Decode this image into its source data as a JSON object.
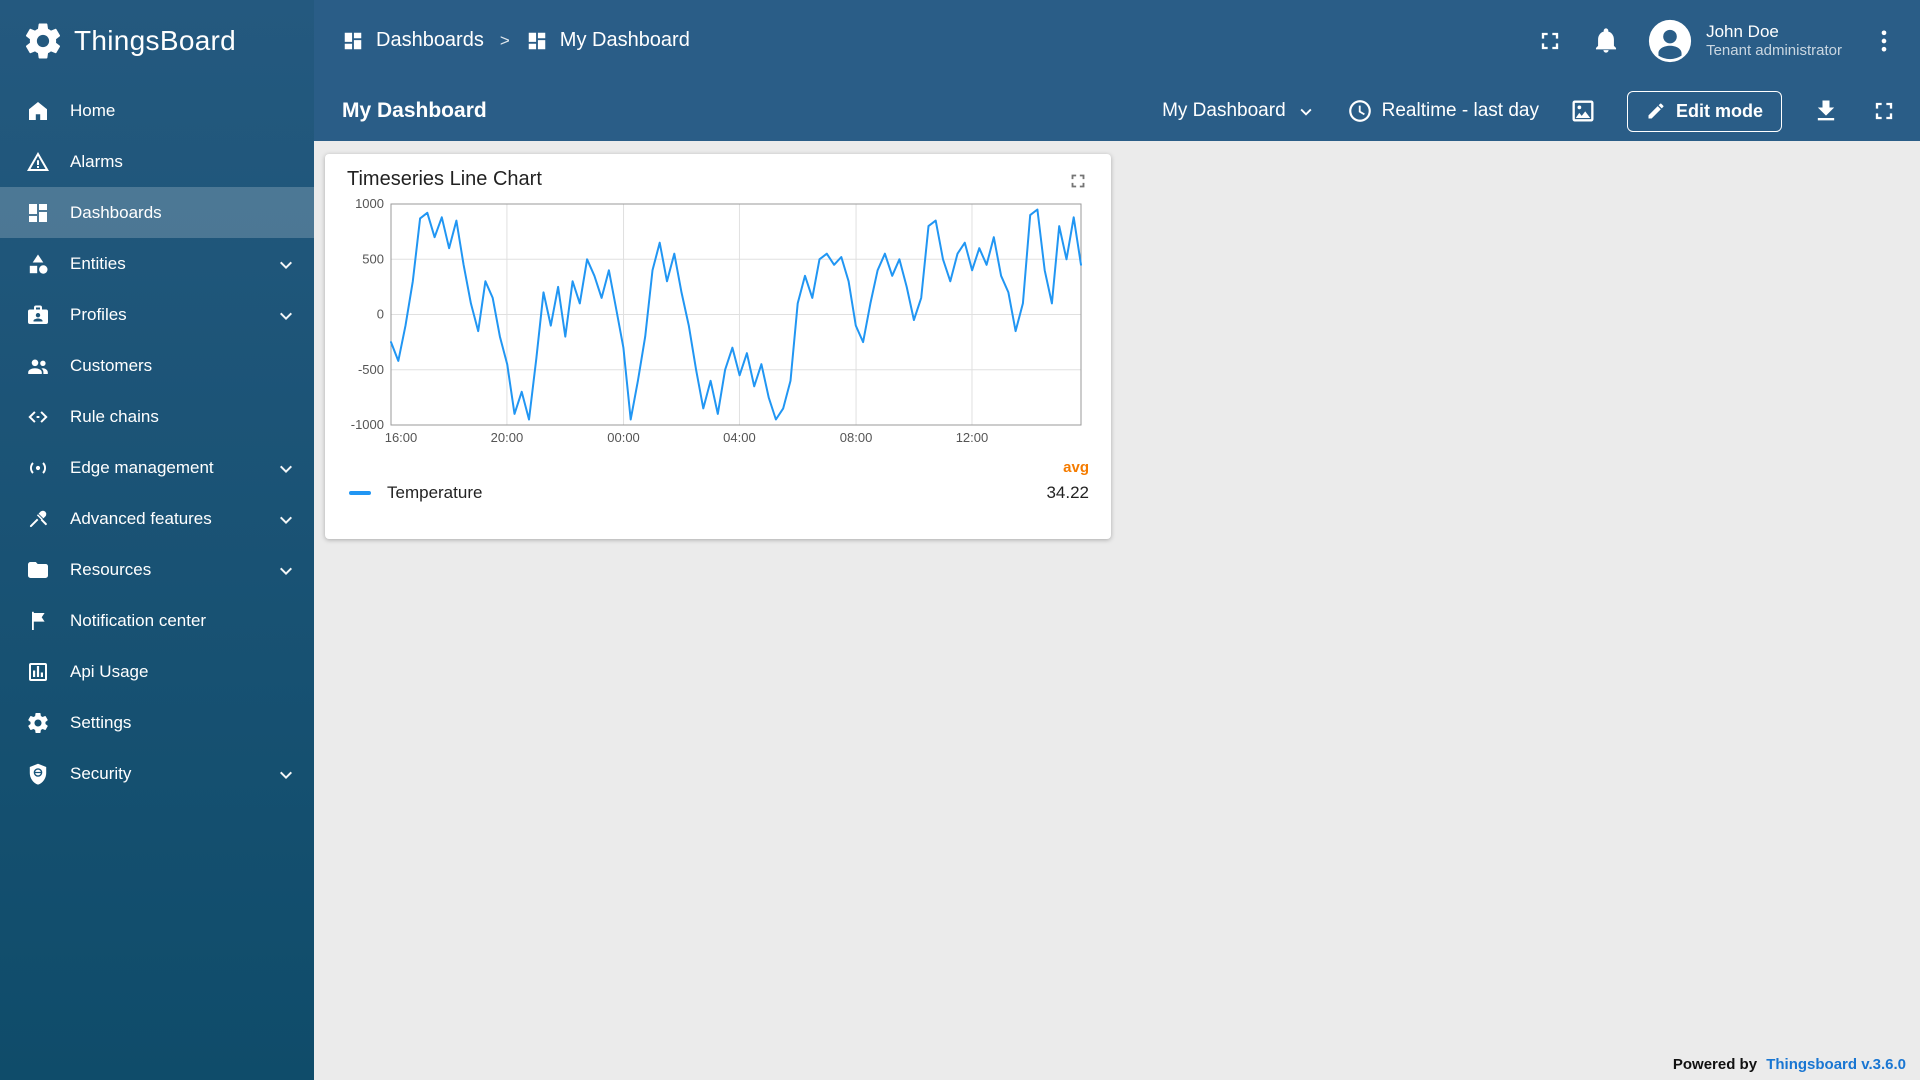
{
  "app": {
    "name": "ThingsBoard"
  },
  "sidebar": {
    "items": [
      {
        "label": "Home",
        "icon": "home",
        "expandable": false,
        "active": false
      },
      {
        "label": "Alarms",
        "icon": "alarms",
        "expandable": false,
        "active": false
      },
      {
        "label": "Dashboards",
        "icon": "dashboards",
        "expandable": false,
        "active": true
      },
      {
        "label": "Entities",
        "icon": "entities",
        "expandable": true,
        "active": false
      },
      {
        "label": "Profiles",
        "icon": "profiles",
        "expandable": true,
        "active": false
      },
      {
        "label": "Customers",
        "icon": "customers",
        "expandable": false,
        "active": false
      },
      {
        "label": "Rule chains",
        "icon": "rule-chains",
        "expandable": false,
        "active": false
      },
      {
        "label": "Edge management",
        "icon": "edge-management",
        "expandable": true,
        "active": false
      },
      {
        "label": "Advanced features",
        "icon": "advanced-features",
        "expandable": true,
        "active": false
      },
      {
        "label": "Resources",
        "icon": "resources",
        "expandable": true,
        "active": false
      },
      {
        "label": "Notification center",
        "icon": "notification-center",
        "expandable": false,
        "active": false
      },
      {
        "label": "Api Usage",
        "icon": "api-usage",
        "expandable": false,
        "active": false
      },
      {
        "label": "Settings",
        "icon": "settings",
        "expandable": false,
        "active": false
      },
      {
        "label": "Security",
        "icon": "security",
        "expandable": true,
        "active": false
      }
    ]
  },
  "header": {
    "breadcrumb": [
      {
        "label": "Dashboards"
      },
      {
        "label": "My Dashboard"
      }
    ],
    "separator": ">",
    "user": {
      "name": "John Doe",
      "role": "Tenant administrator"
    }
  },
  "toolbar": {
    "title": "My Dashboard",
    "dashboard_selector": "My Dashboard",
    "time_window": "Realtime - last day",
    "edit_button": "Edit mode"
  },
  "widget": {
    "title": "Timeseries Line Chart",
    "legend": {
      "agg_label": "avg",
      "series_name": "Temperature",
      "agg_value": "34.22"
    }
  },
  "footer": {
    "prefix": "Powered by",
    "link": "Thingsboard v.3.6.0"
  },
  "chart_data": {
    "type": "line",
    "title": "Timeseries Line Chart",
    "xlabel": "",
    "ylabel": "",
    "ylim": [
      -1000,
      1000
    ],
    "y_ticks": [
      1000,
      500,
      0,
      -500,
      -1000
    ],
    "x_ticks": [
      {
        "label": "16:00",
        "frac": 0
      },
      {
        "label": "20:00",
        "frac": 0.168
      },
      {
        "label": "00:00",
        "frac": 0.337
      },
      {
        "label": "04:00",
        "frac": 0.505
      },
      {
        "label": "08:00",
        "frac": 0.674
      },
      {
        "label": "12:00",
        "frac": 0.842
      }
    ],
    "grid": true,
    "legend_position": "bottom",
    "series": [
      {
        "name": "Temperature",
        "color": "#2196f3",
        "avg": 34.22,
        "values": [
          -250,
          -420,
          -100,
          300,
          870,
          920,
          700,
          880,
          600,
          850,
          450,
          100,
          -150,
          300,
          150,
          -200,
          -450,
          -900,
          -700,
          -950,
          -400,
          200,
          -100,
          250,
          -200,
          300,
          100,
          500,
          350,
          150,
          400,
          50,
          -300,
          -950,
          -600,
          -200,
          400,
          650,
          300,
          550,
          200,
          -100,
          -500,
          -850,
          -600,
          -900,
          -500,
          -300,
          -550,
          -350,
          -650,
          -450,
          -750,
          -950,
          -850,
          -600,
          100,
          350,
          150,
          500,
          550,
          450,
          520,
          300,
          -100,
          -250,
          100,
          400,
          550,
          350,
          500,
          250,
          -50,
          150,
          800,
          850,
          500,
          300,
          550,
          650,
          400,
          600,
          450,
          700,
          350,
          200,
          -150,
          100,
          900,
          950,
          400,
          100,
          800,
          500,
          880,
          450
        ]
      }
    ]
  }
}
